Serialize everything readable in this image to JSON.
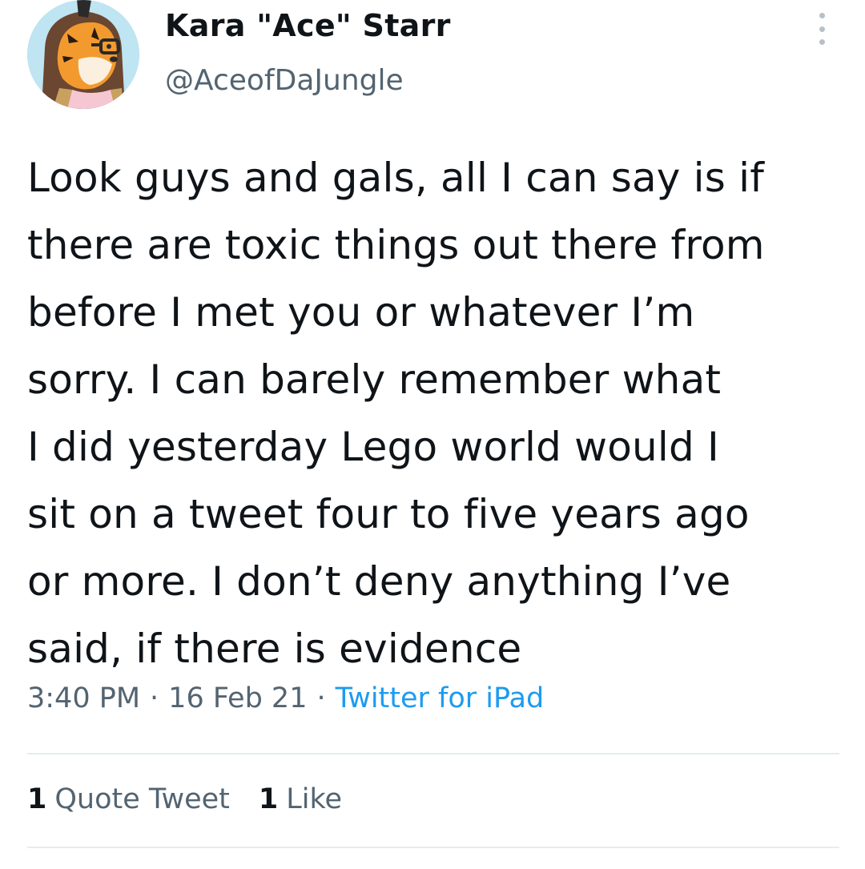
{
  "user": {
    "display_name": "Kara \"Ace\" Starr",
    "handle": "@AceofDaJungle",
    "avatar_icon": "tiger-character-avatar"
  },
  "menu_icon": "more-vertical-icon",
  "tweet": {
    "lines": [
      "Look guys and gals, all I can say is if",
      "there are toxic things out there from",
      "before I met you or whatever I’m",
      "sorry. I can barely remember what",
      "I did yesterday Lego world would I",
      "sit on a tweet four to five years ago",
      "or more. I don’t deny anything I’ve",
      "said, if there is evidence"
    ]
  },
  "meta": {
    "time": "3:40 PM",
    "separator": "·",
    "date": "16 Feb 21",
    "source": "Twitter for iPad"
  },
  "stats": {
    "quote_count": "1",
    "quote_label": "Quote Tweet",
    "like_count": "1",
    "like_label": "Like"
  },
  "colors": {
    "text": "#0f1419",
    "secondary": "#536471",
    "link": "#1d9bf0",
    "divider": "#e6ecf0"
  }
}
